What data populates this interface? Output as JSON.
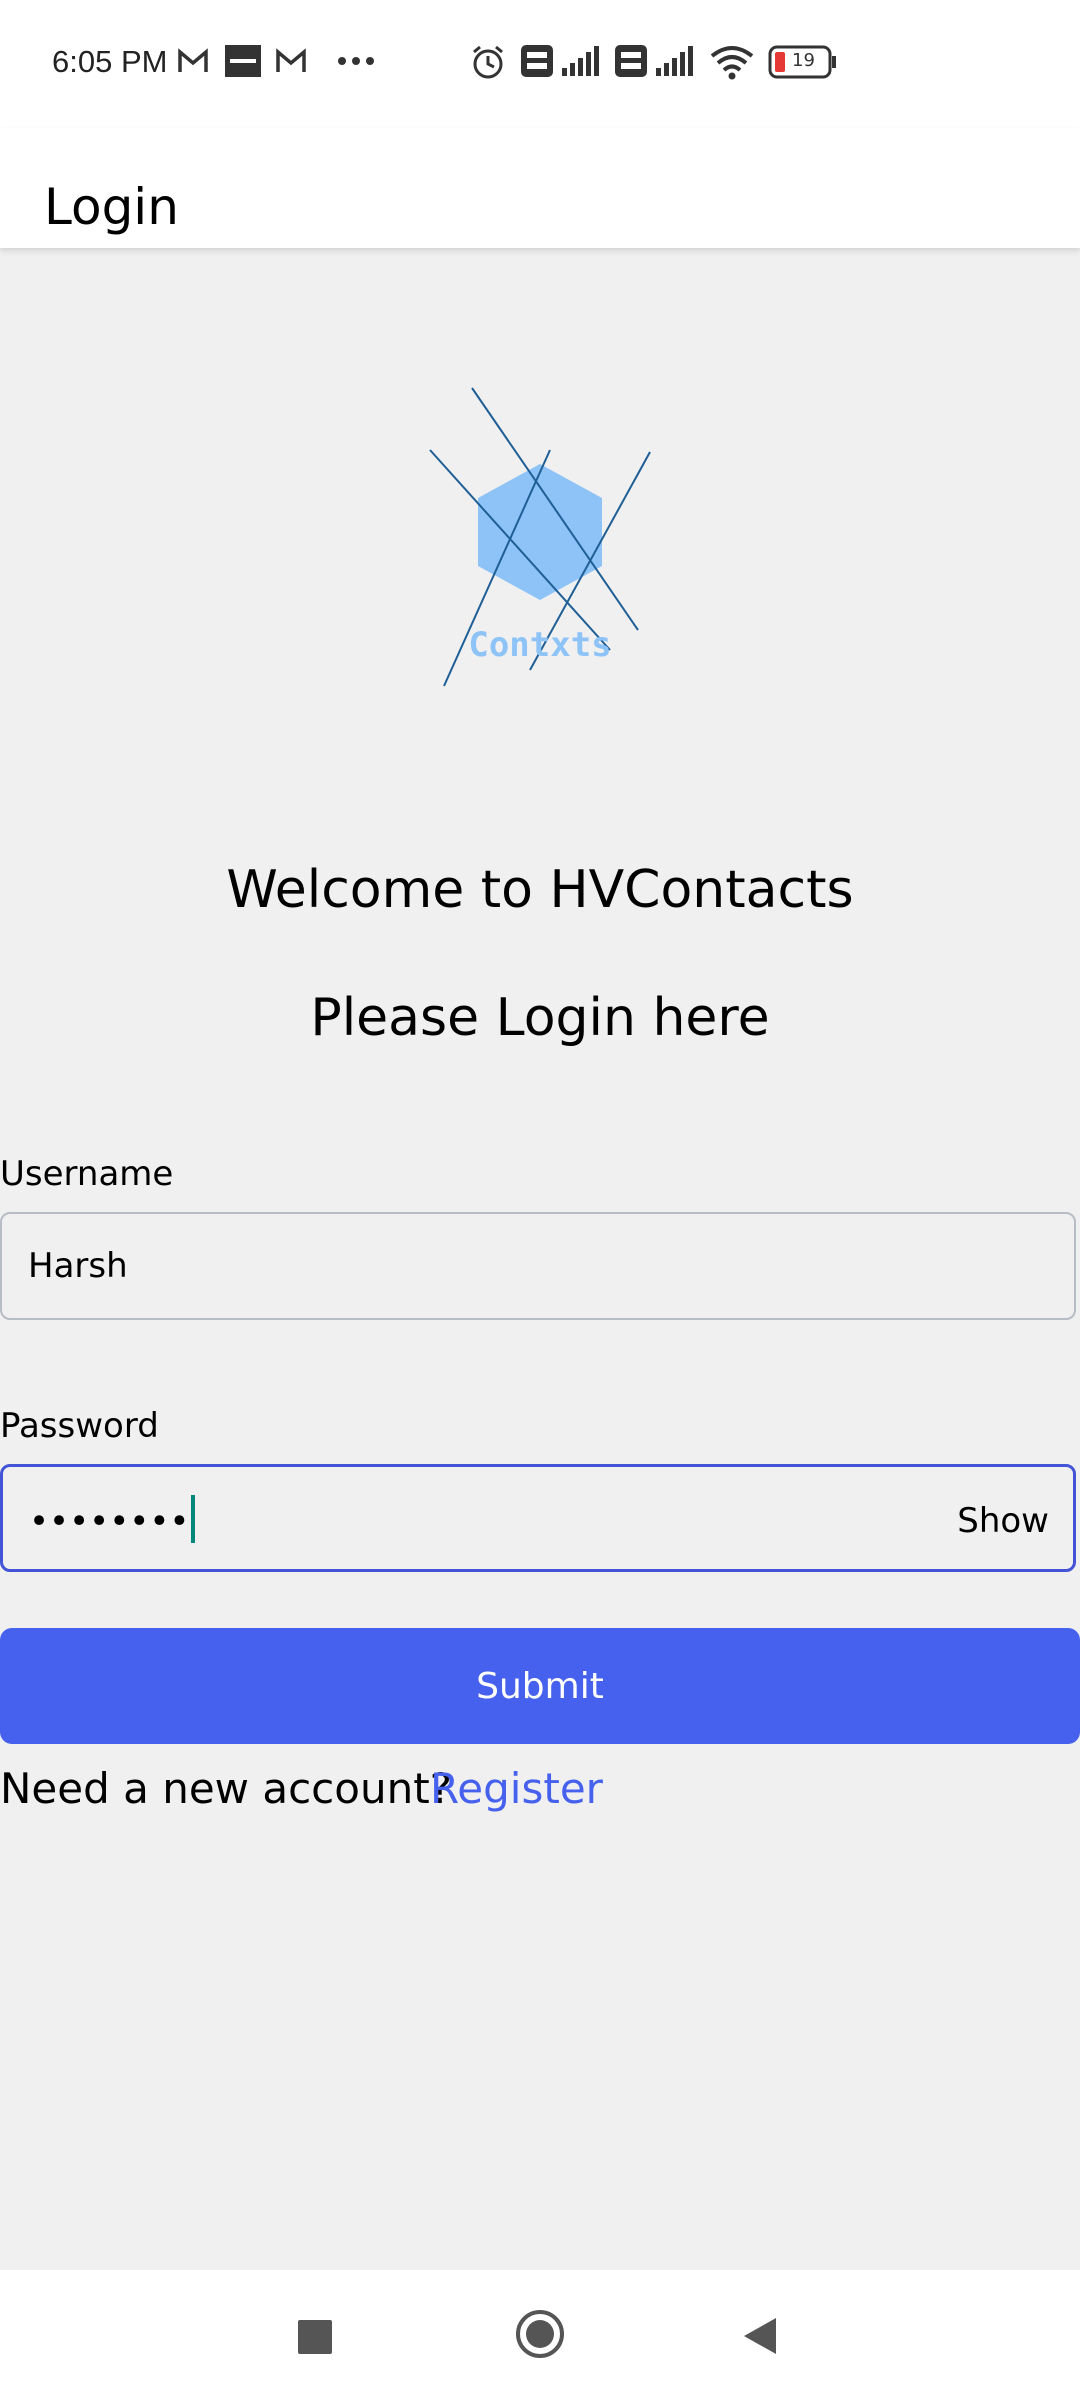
{
  "status_bar": {
    "time": "6:05 PM",
    "icons": [
      "gmail-icon",
      "zomato-icon",
      "gmail-icon",
      "more-dots-icon",
      "alarm-icon",
      "volte-icon",
      "signal-icon",
      "volte-icon",
      "signal-icon",
      "wifi-icon",
      "battery-icon"
    ],
    "battery_level": "19"
  },
  "app_bar": {
    "title": "Login"
  },
  "logo": {
    "text": "Contxts",
    "color": "#8ec3f7"
  },
  "welcome": {
    "heading": "Welcome to HVContacts",
    "subheading": "Please Login here"
  },
  "form": {
    "username_label": "Username",
    "username_value": "Harsh",
    "password_label": "Password",
    "password_value": "••••••••",
    "show_label": "Show",
    "submit_label": "Submit"
  },
  "footer": {
    "prompt": "Need a new account?",
    "register_link": "Register"
  },
  "colors": {
    "accent": "#4561ee",
    "focus_border": "#4355d6",
    "caret": "#00897b",
    "background": "#f0f0f0"
  },
  "nav_bar": {
    "icons": [
      "recent-apps-icon",
      "home-icon",
      "back-icon"
    ]
  }
}
